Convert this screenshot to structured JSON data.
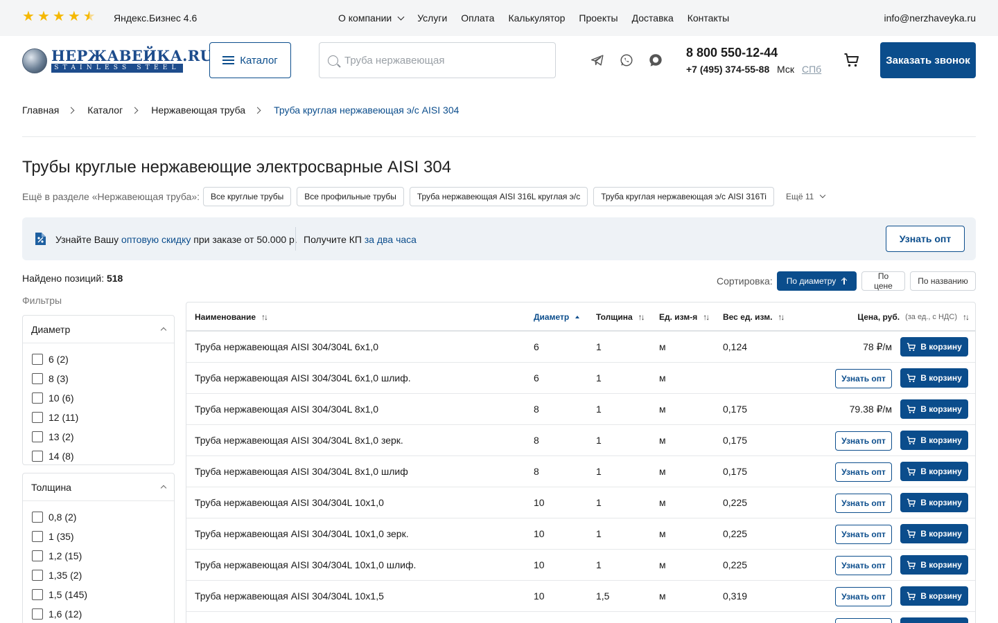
{
  "topbar": {
    "stars": [
      "★",
      "★",
      "★",
      "★",
      "★"
    ],
    "rating_label": "Яндекс.Бизнес 4.6",
    "nav": [
      "О компании",
      "Услуги",
      "Оплата",
      "Калькулятор",
      "Проекты",
      "Доставка",
      "Контакты"
    ],
    "email": "info@nerzhaveyka.ru"
  },
  "header": {
    "logo_top": "НЕРЖАВЕЙКА.RU",
    "logo_bottom": "STAINLESS STEEL",
    "catalog_label": "Каталог",
    "search_placeholder": "Труба нержавеющая",
    "phone_main": "8 800 550-12-44",
    "phone_sub": "+7 (495) 374-55-88",
    "city_msk": "Мск",
    "city_spb": "СПб",
    "call_label": "Заказать звонок",
    "icons": [
      "telegram-icon",
      "whatsapp-icon",
      "chat-icon",
      "cart-icon"
    ]
  },
  "breadcrumb": [
    "Главная",
    "Каталог",
    "Нержавеющая труба",
    "Труба круглая нержавеющая э/с AISI 304"
  ],
  "page": {
    "title": "Трубы круглые нержавеющие электросварные AISI 304",
    "section_label": "Ещё в разделе «Нержавеющая труба»:",
    "chips": [
      "Все круглые трубы",
      "Все профильные трубы",
      "Труба нержавеющая AISI 316L круглая э/с",
      "Труба круглая нержавеющая э/с AISI 316Ti"
    ],
    "more_label": "Ещё 11"
  },
  "banner": {
    "t1_a": "Узнайте Вашу ",
    "t1_link": "оптовую скидку",
    "t1_b": " при заказе от 50.000 р.",
    "t2_a": "Получите КП ",
    "t2_link": "за два часа",
    "button": "Узнать опт"
  },
  "listing": {
    "found_label": "Найдено позиций:",
    "found_count": "518",
    "filters_label": "Фильтры",
    "sort_label": "Сортировка:",
    "sort_options": [
      "По диаметру",
      "По цене",
      "По названию"
    ]
  },
  "filters": [
    {
      "title": "Диаметр",
      "options": [
        "6 (2)",
        "8 (3)",
        "10 (6)",
        "12 (11)",
        "13 (2)",
        "14 (8)"
      ]
    },
    {
      "title": "Толщина",
      "options": [
        "0,8 (2)",
        "1 (35)",
        "1,2 (15)",
        "1,35 (2)",
        "1,5 (145)",
        "1,6 (12)"
      ]
    }
  ],
  "table": {
    "headers": {
      "name": "Наименование",
      "diameter": "Диаметр",
      "thickness": "Толщина",
      "unit": "Ед. изм-я",
      "weight": "Вес ед. изм.",
      "price": "Цена, руб.",
      "price_note": "(за ед., с НДС)"
    },
    "opt_label": "Узнать опт",
    "cart_label": "В корзину",
    "rows": [
      {
        "name": "Труба нержавеющая AISI 304/304L 6х1,0",
        "diameter": "6",
        "thickness": "1",
        "unit": "м",
        "weight": "0,124",
        "price": "78 ₽/м"
      },
      {
        "name": "Труба нержавеющая AISI 304/304L 6х1,0 шлиф.",
        "diameter": "6",
        "thickness": "1",
        "unit": "м",
        "weight": "",
        "price": ""
      },
      {
        "name": "Труба нержавеющая AISI 304/304L 8х1,0",
        "diameter": "8",
        "thickness": "1",
        "unit": "м",
        "weight": "0,175",
        "price": "79.38 ₽/м"
      },
      {
        "name": "Труба нержавеющая AISI 304/304L 8х1,0 зерк.",
        "diameter": "8",
        "thickness": "1",
        "unit": "м",
        "weight": "0,175",
        "price": ""
      },
      {
        "name": "Труба нержавеющая AISI 304/304L 8х1,0 шлиф",
        "diameter": "8",
        "thickness": "1",
        "unit": "м",
        "weight": "0,175",
        "price": ""
      },
      {
        "name": "Труба нержавеющая AISI 304/304L 10х1,0",
        "diameter": "10",
        "thickness": "1",
        "unit": "м",
        "weight": "0,225",
        "price": ""
      },
      {
        "name": "Труба нержавеющая AISI 304/304L 10х1,0 зерк.",
        "diameter": "10",
        "thickness": "1",
        "unit": "м",
        "weight": "0,225",
        "price": ""
      },
      {
        "name": "Труба нержавеющая AISI 304/304L 10х1,0 шлиф.",
        "diameter": "10",
        "thickness": "1",
        "unit": "м",
        "weight": "0,225",
        "price": ""
      },
      {
        "name": "Труба нержавеющая AISI 304/304L 10х1,5",
        "diameter": "10",
        "thickness": "1,5",
        "unit": "м",
        "weight": "0,319",
        "price": ""
      }
    ]
  },
  "colors": {
    "brand": "#0b4d8c",
    "star": "#f5b800",
    "banner_bg": "#eef2f6"
  }
}
